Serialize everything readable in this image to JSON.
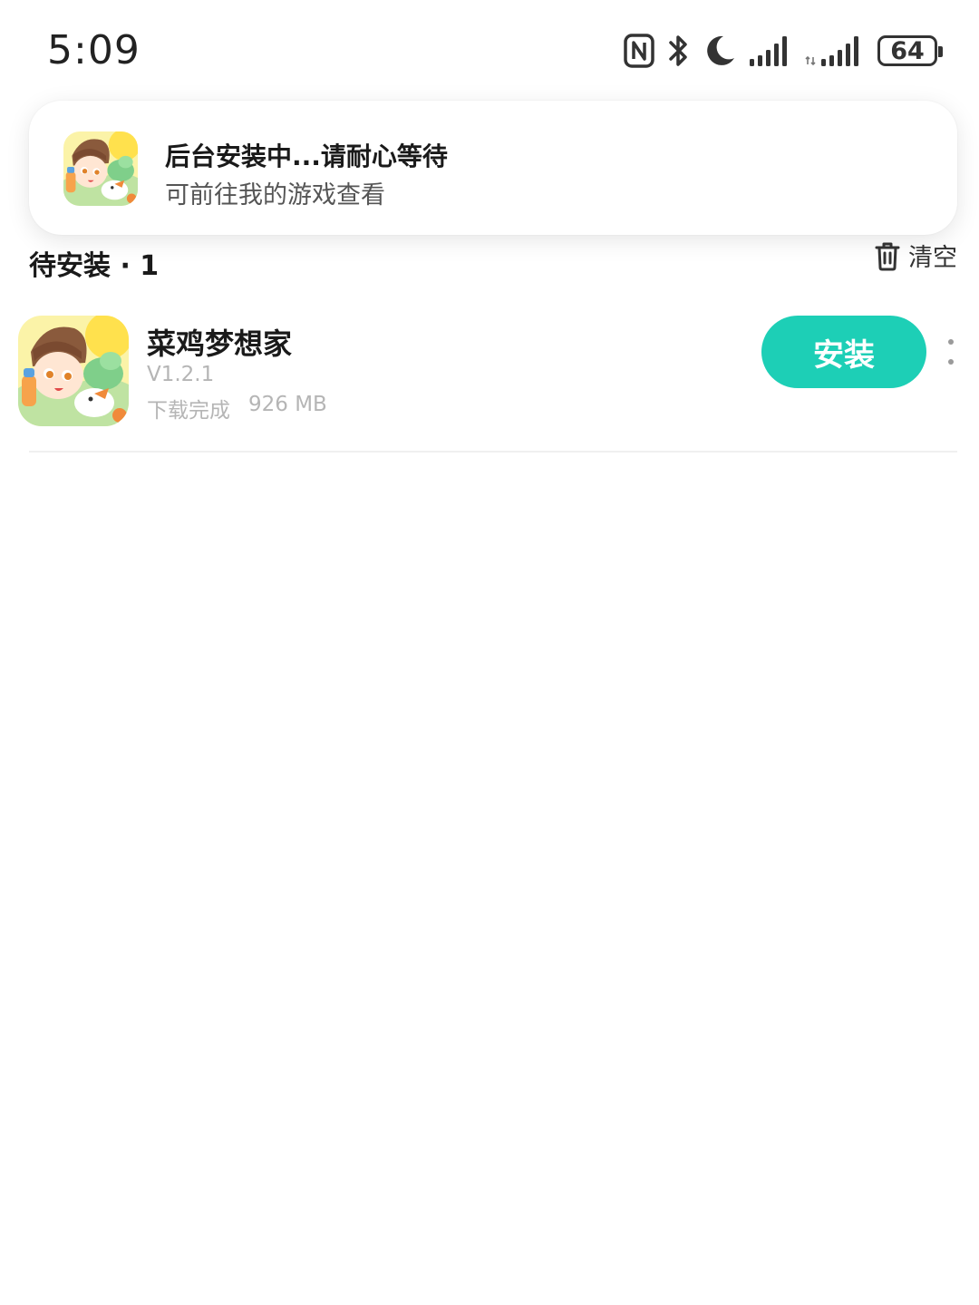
{
  "status_bar": {
    "time": "5:09",
    "battery": "64",
    "icons": [
      "nfc-icon",
      "bluetooth-icon",
      "moon-icon",
      "signal-icon",
      "signal-icon"
    ]
  },
  "notification": {
    "title": "后台安装中...请耐心等待",
    "subtitle": "可前往我的游戏查看"
  },
  "section": {
    "title": "待安装 · 1",
    "clear_label": "清空"
  },
  "apps": [
    {
      "name": "菜鸡梦想家",
      "version": "V1.2.1",
      "status": "下载完成",
      "size": "926 MB",
      "action_label": "安装"
    }
  ],
  "colors": {
    "accent": "#1dcfb6",
    "muted_text": "#b5b5b5"
  }
}
